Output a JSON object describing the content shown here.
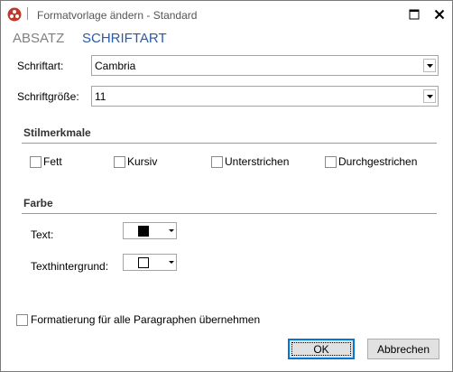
{
  "window": {
    "title": "Formatvorlage ändern - Standard"
  },
  "tabs": [
    {
      "label": "ABSATZ",
      "active": false
    },
    {
      "label": "SCHRIFTART",
      "active": true
    }
  ],
  "font": {
    "label": "Schriftart:",
    "value": "Cambria"
  },
  "size": {
    "label": "Schriftgröße:",
    "value": "11"
  },
  "style_section": {
    "title": "Stilmerkmale",
    "options": [
      {
        "label": "Fett",
        "checked": false
      },
      {
        "label": "Kursiv",
        "checked": false
      },
      {
        "label": "Unterstrichen",
        "checked": false
      },
      {
        "label": "Durchgestrichen",
        "checked": false
      }
    ]
  },
  "color_section": {
    "title": "Farbe",
    "text_label": "Text:",
    "text_color": "#000000",
    "background_label": "Texthintergrund:",
    "background_color": "#ffffff"
  },
  "apply_all": {
    "label": "Formatierung für alle Paragraphen übernehmen",
    "checked": false
  },
  "buttons": {
    "ok": "OK",
    "cancel": "Abbrechen"
  },
  "colors": {
    "accent": "#2a5aa6",
    "inactive_tab": "#808080",
    "app_icon": "#c0392b"
  }
}
